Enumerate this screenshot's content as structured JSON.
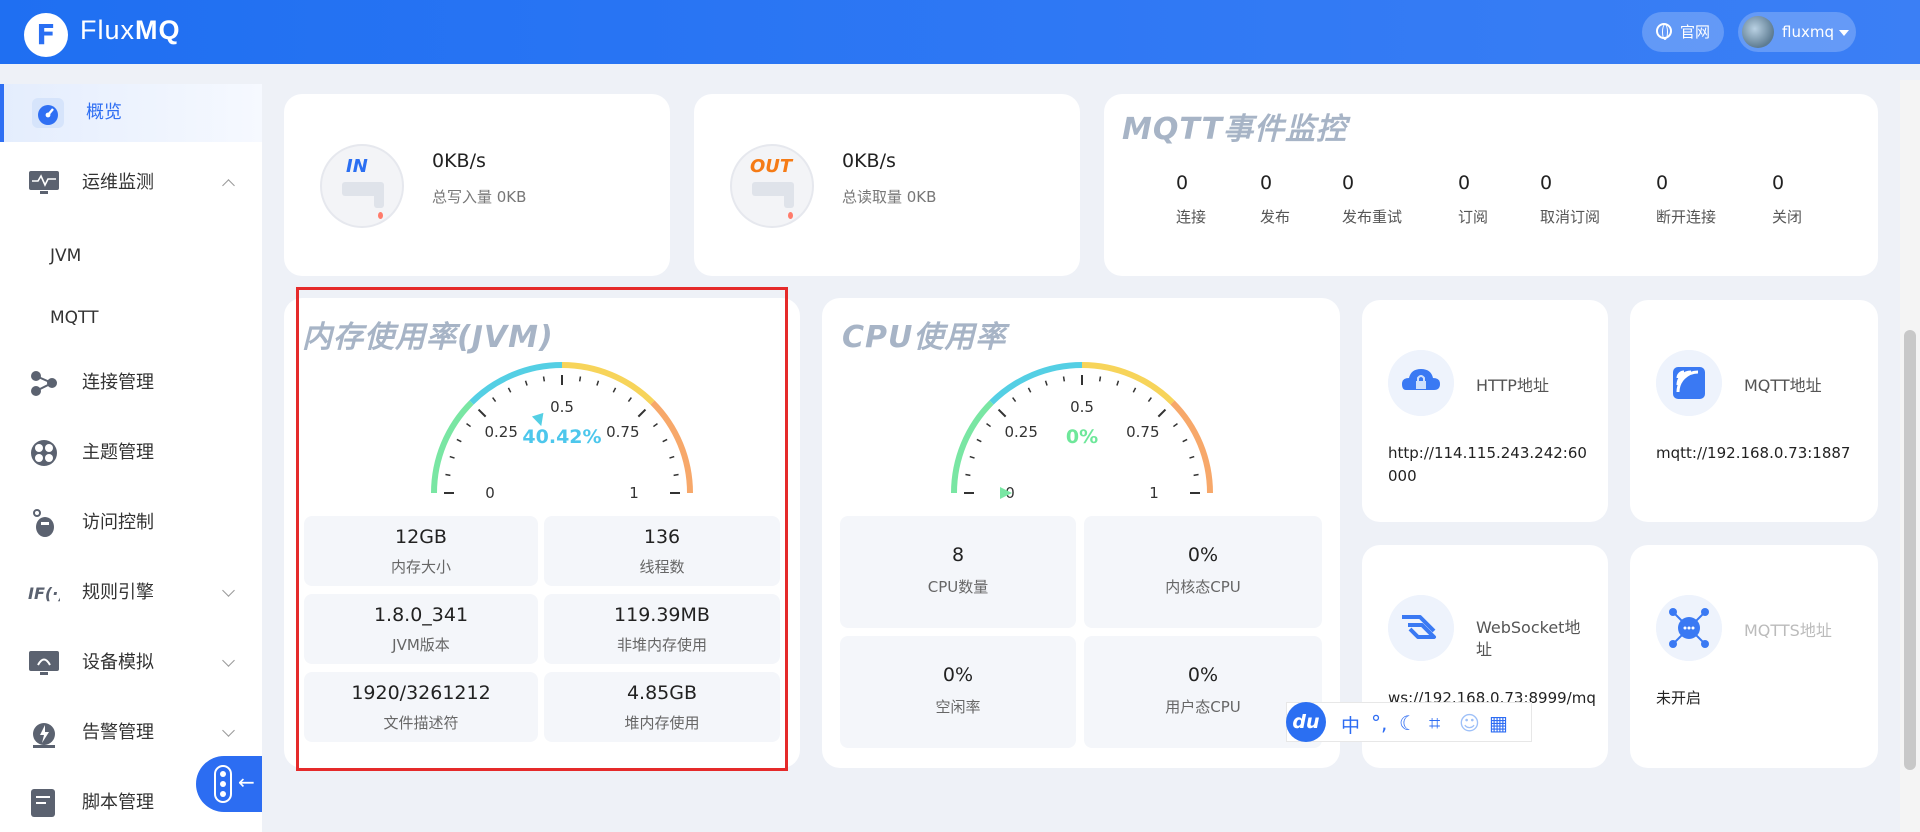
{
  "app": {
    "logo_letter": "F",
    "name_light": "Flux",
    "name_bold": "MQ"
  },
  "header": {
    "official_label": "官网",
    "user_name": "fluxmq"
  },
  "sidebar": {
    "items": [
      {
        "label": "概览",
        "icon": "dashboard-icon"
      },
      {
        "label": "运维监测",
        "icon": "monitor-icon",
        "sub": [
          "JVM",
          "MQTT"
        ]
      },
      {
        "label": "连接管理",
        "icon": "connection-icon"
      },
      {
        "label": "主题管理",
        "icon": "topic-icon"
      },
      {
        "label": "访问控制",
        "icon": "access-control-icon"
      },
      {
        "label": "规则引擎",
        "icon": "rule-engine-icon"
      },
      {
        "label": "设备模拟",
        "icon": "device-sim-icon"
      },
      {
        "label": "告警管理",
        "icon": "alarm-icon"
      },
      {
        "label": "脚本管理",
        "icon": "script-icon"
      }
    ]
  },
  "io": {
    "in": {
      "tag": "IN",
      "value": "0KB/s",
      "sub": "总写入量 0KB"
    },
    "out": {
      "tag": "OUT",
      "value": "0KB/s",
      "sub": "总读取量 0KB"
    }
  },
  "mqtt_events": {
    "title": "MQTT事件监控",
    "items": [
      {
        "value": "0",
        "label": "连接"
      },
      {
        "value": "0",
        "label": "发布"
      },
      {
        "value": "0",
        "label": "发布重试"
      },
      {
        "value": "0",
        "label": "订阅"
      },
      {
        "value": "0",
        "label": "取消订阅"
      },
      {
        "value": "0",
        "label": "断开连接"
      },
      {
        "value": "0",
        "label": "关闭"
      }
    ]
  },
  "jvm": {
    "title": "内存使用率(JVM)",
    "gauge": {
      "value": 0.4042,
      "display": "40.42%",
      "ticks": [
        "0",
        "0.25",
        "0.5",
        "0.75",
        "1"
      ]
    },
    "stats": [
      {
        "value": "12GB",
        "label": "内存大小"
      },
      {
        "value": "136",
        "label": "线程数"
      },
      {
        "value": "1.8.0_341",
        "label": "JVM版本"
      },
      {
        "value": "119.39MB",
        "label": "非堆内存使用"
      },
      {
        "value": "1920/3261212",
        "label": "文件描述符"
      },
      {
        "value": "4.85GB",
        "label": "堆内存使用"
      }
    ]
  },
  "cpu": {
    "title": "CPU使用率",
    "gauge": {
      "value": 0,
      "display": "0%",
      "ticks": [
        "0",
        "0.25",
        "0.5",
        "0.75",
        "1"
      ]
    },
    "stats": [
      {
        "value": "8",
        "label": "CPU数量"
      },
      {
        "value": "0%",
        "label": "内核态CPU"
      },
      {
        "value": "0%",
        "label": "空闲率"
      },
      {
        "value": "0%",
        "label": "用户态CPU"
      }
    ]
  },
  "addresses": [
    {
      "title": "HTTP地址",
      "value": "http://114.115.243.242:60000",
      "icon": "cloud-lock-icon"
    },
    {
      "title": "MQTT地址",
      "value": "mqtt://192.168.0.73:1887",
      "icon": "signal-icon"
    },
    {
      "title": "WebSocket地址",
      "value": "ws://192.168.0.73:8999/mq",
      "icon": "websocket-icon"
    },
    {
      "title": "MQTTS地址",
      "value": "未开启",
      "icon": "network-icon"
    }
  ],
  "toolbar": {
    "du": "du",
    "zh": "中"
  },
  "colors": {
    "primary": "#2f6ff3",
    "highlight": "#e52a2a",
    "gauge_jvm_value": "#4dc7ec",
    "gauge_cpu_value": "#6ee79a"
  }
}
